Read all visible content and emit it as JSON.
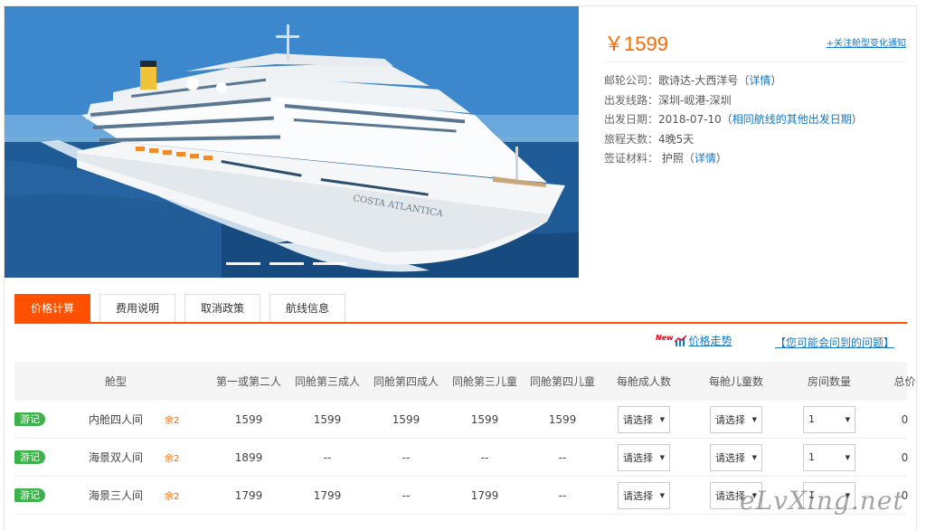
{
  "hero": {
    "ship_name_on_hull": "COSTA ATLANTICA",
    "slide_count": 3
  },
  "info": {
    "price": "￥1599",
    "follow_link": "+关注舱型变化通知",
    "rows": [
      {
        "label": "邮轮公司：",
        "value": "歌诗达-大西洋号",
        "link": "详情",
        "pre": "（",
        "post": "）"
      },
      {
        "label": "出发线路：",
        "value": "深圳-岘港-深圳"
      },
      {
        "label": "出发日期：",
        "value": "2018-07-10",
        "link": "相同航线的其他出发日期",
        "pre": "（",
        "post": "）"
      },
      {
        "label": "旅程天数：",
        "value": "4晚5天"
      },
      {
        "label": "签证材料：",
        "value": " 护照",
        "link": "详情",
        "pre": "（",
        "post": "）"
      }
    ]
  },
  "tabs": [
    "价格计算",
    "费用说明",
    "取消政策",
    "航线信息"
  ],
  "links": {
    "new_badge": "New",
    "trend": "价格走势",
    "faq": "【您可能会问到的问题】"
  },
  "table": {
    "headers": [
      "",
      "舱型",
      "",
      "第一或第二人",
      "同舱第三成人",
      "同舱第四成人",
      "同舱第三儿童",
      "同舱第四儿童",
      "每舱成人数",
      "每舱儿童数",
      "房间数量",
      "总价"
    ],
    "rows": [
      {
        "tag": "游记",
        "cabin": "内舱四人间",
        "left": "余2",
        "p1": "1599",
        "p2": "1599",
        "p3": "1599",
        "p4": "1599",
        "p5": "1599",
        "adults": "请选择",
        "children": "请选择",
        "rooms": "1",
        "total": "0"
      },
      {
        "tag": "游记",
        "cabin": "海景双人间",
        "left": "余2",
        "p1": "1899",
        "p2": "--",
        "p3": "--",
        "p4": "--",
        "p5": "--",
        "adults": "请选择",
        "children": "请选择",
        "rooms": "1",
        "total": "0"
      },
      {
        "tag": "游记",
        "cabin": "海景三人间",
        "left": "余2",
        "p1": "1799",
        "p2": "1799",
        "p3": "--",
        "p4": "1799",
        "p5": "--",
        "adults": "请选择",
        "children": "请选择",
        "rooms": "1",
        "total": "0"
      }
    ]
  },
  "watermark": "eLvXing.net",
  "colors": {
    "accent": "#ff5100",
    "price": "#ff6600",
    "link": "#1478c8",
    "tag": "#3cb34a"
  }
}
